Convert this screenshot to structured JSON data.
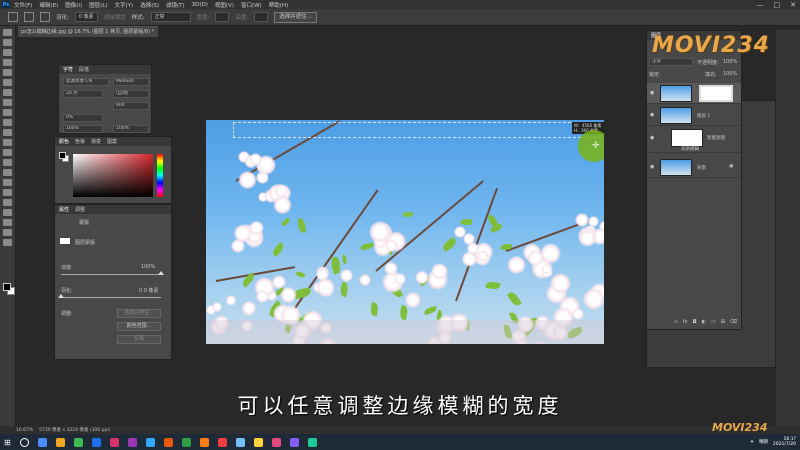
{
  "app": {
    "logo": "Ps"
  },
  "menubar": {
    "items": [
      "文件(F)",
      "编辑(E)",
      "图像(I)",
      "图层(L)",
      "文字(Y)",
      "选择(S)",
      "滤镜(T)",
      "3D(D)",
      "视图(V)",
      "窗口(W)",
      "帮助(H)"
    ],
    "window_controls": [
      "—",
      "□",
      "✕"
    ]
  },
  "options": {
    "feather_label": "羽化:",
    "feather_value": "0 像素",
    "antialias_label": "消除锯齿",
    "style_label": "样式:",
    "style_value": "正常",
    "width_label": "宽度:",
    "height_label": "高度:",
    "select_mask_button": "选择并遮住..."
  },
  "document": {
    "tab_title": "ps怎么模糊边缘.jpg @ 16.7% (图层 1 拷贝, 图层蒙版/8) *",
    "tab_close": "×"
  },
  "character_panel": {
    "tabs": [
      "字符",
      "段落"
    ],
    "font_family": "思源黑体 CN",
    "font_style": "Medium",
    "font_size": "20 点",
    "leading": "(自动)",
    "tracking": "600",
    "scale": "0%",
    "vscale": "100%",
    "hscale": "100%"
  },
  "color_panel": {
    "tabs": [
      "颜色",
      "色板",
      "渐变",
      "图案"
    ]
  },
  "properties_panel": {
    "tabs": [
      "属性",
      "调整"
    ],
    "mask_type": "蒙版",
    "layer_mask_label": "图层蒙版",
    "density_label": "浓度:",
    "density_value": "100%",
    "feather_label": "羽化:",
    "feather_value": "0.0 像素",
    "adjust_label": "调整:",
    "select_mask_button": "选择并遮住...",
    "color_range_button": "颜色范围...",
    "invert_button": "反相"
  },
  "layers_panel": {
    "tab": "图层",
    "blend_mode": "正常",
    "opacity_label": "不透明度:",
    "opacity_value": "100%",
    "lock_label": "锁定:",
    "fill_label": "填充:",
    "fill_value": "100%",
    "layers": [
      {
        "name": "",
        "visible": true
      },
      {
        "name": "图层 1",
        "visible": true
      },
      {
        "name": "智能滤镜",
        "visible": true
      },
      {
        "name": "高斯模糊",
        "visible": true
      },
      {
        "name": "背景",
        "visible": true
      }
    ]
  },
  "canvas_overlay": {
    "dims_w": "W：4566 像素",
    "dims_h": "H：366 像素"
  },
  "watermark": "MOVI234",
  "caption": "可以任意调整边缘模糊的宽度",
  "status": {
    "zoom": "16.67%",
    "doc_size": "5730 像素 x 3224 像素 (300 ppi)"
  },
  "taskbar": {
    "weather": "晴朗",
    "time": "16:1?",
    "date": "2021/7/20",
    "icon_colors": [
      "#4a8cff",
      "#f5a623",
      "#3fb950",
      "#1f6feb",
      "#d6336c",
      "#9c36b5",
      "#31a8ff",
      "#e8590c",
      "#2f9e44",
      "#fd7e14",
      "#f03e3e",
      "#74c0fc",
      "#ffd43b",
      "#e64980",
      "#845ef7",
      "#20c997"
    ]
  }
}
